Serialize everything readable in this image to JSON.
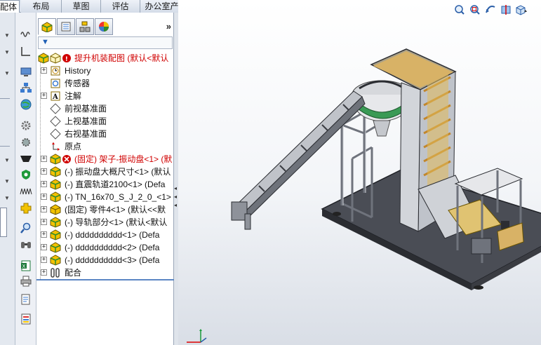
{
  "command_tabs": [
    {
      "label": "配体"
    },
    {
      "label": "布局"
    },
    {
      "label": "草图"
    },
    {
      "label": "评估"
    },
    {
      "label": "办公室产品"
    }
  ],
  "feature_tree": {
    "root": {
      "label": "提升机装配图 (默认<默认"
    },
    "items": [
      {
        "label": "History"
      },
      {
        "label": "传感器"
      },
      {
        "label": "注解"
      },
      {
        "label": "前视基准面"
      },
      {
        "label": "上视基准面"
      },
      {
        "label": "右视基准面"
      },
      {
        "label": "原点"
      },
      {
        "label": "(固定) 架子-振动盘<1> (默"
      },
      {
        "label": "(-) 振动盘大概尺寸<1> (默认"
      },
      {
        "label": "(-) 直震轨道2100<1> (Defa"
      },
      {
        "label": "(-) TN_16x70_S_J_2_0_<1> <"
      },
      {
        "label": "(固定) 零件4<1> (默认<<默"
      },
      {
        "label": "(-) 导轨部分<1> (默认<默认"
      },
      {
        "label": "(-) dddddddddd<1> (Defa"
      },
      {
        "label": "(-) dddddddddd<2> (Defa"
      },
      {
        "label": "(-) dddddddddd<3> (Defa"
      },
      {
        "label": "配合"
      }
    ]
  },
  "colors": {
    "accent": "#5b86c4",
    "error_red": "#d00000",
    "assembly_yellow": "#f2c200",
    "assembly_green": "#2e8b2e"
  }
}
